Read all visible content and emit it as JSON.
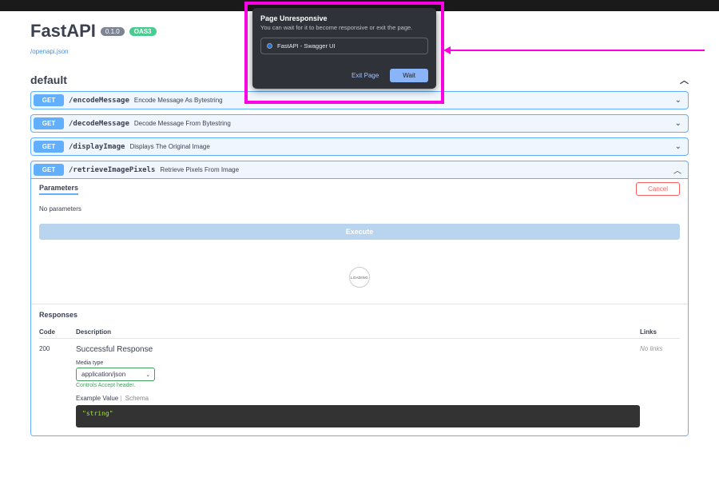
{
  "header": {
    "title": "FastAPI",
    "version": "0.1.0",
    "oas": "OAS3",
    "spec_link": "/openapi.json"
  },
  "section": {
    "name": "default"
  },
  "endpoints": [
    {
      "method": "GET",
      "path": "/encodeMessage",
      "desc": "Encode Message As Bytestring"
    },
    {
      "method": "GET",
      "path": "/decodeMessage",
      "desc": "Decode Message From Bytestring"
    },
    {
      "method": "GET",
      "path": "/displayImage",
      "desc": "Displays The Original Image"
    },
    {
      "method": "GET",
      "path": "/retrieveImagePixels",
      "desc": "Retrieve Pixels From Image"
    }
  ],
  "expanded": {
    "params_label": "Parameters",
    "cancel": "Cancel",
    "no_params": "No parameters",
    "execute": "Execute",
    "loading": "LOADING",
    "responses_label": "Responses",
    "columns": {
      "code": "Code",
      "desc": "Description",
      "links": "Links"
    },
    "row": {
      "code": "200",
      "desc": "Successful Response",
      "links": "No links"
    },
    "media_label": "Media type",
    "media_value": "application/json",
    "controls_hint": "Controls Accept header.",
    "example_label": "Example Value",
    "schema_label": "Schema",
    "example_body": "\"string\""
  },
  "dialog": {
    "title": "Page Unresponsive",
    "message": "You can wait for it to become responsive or exit the page.",
    "item": "FastAPI - Swagger UI",
    "exit": "Exit Page",
    "wait": "Wait"
  }
}
